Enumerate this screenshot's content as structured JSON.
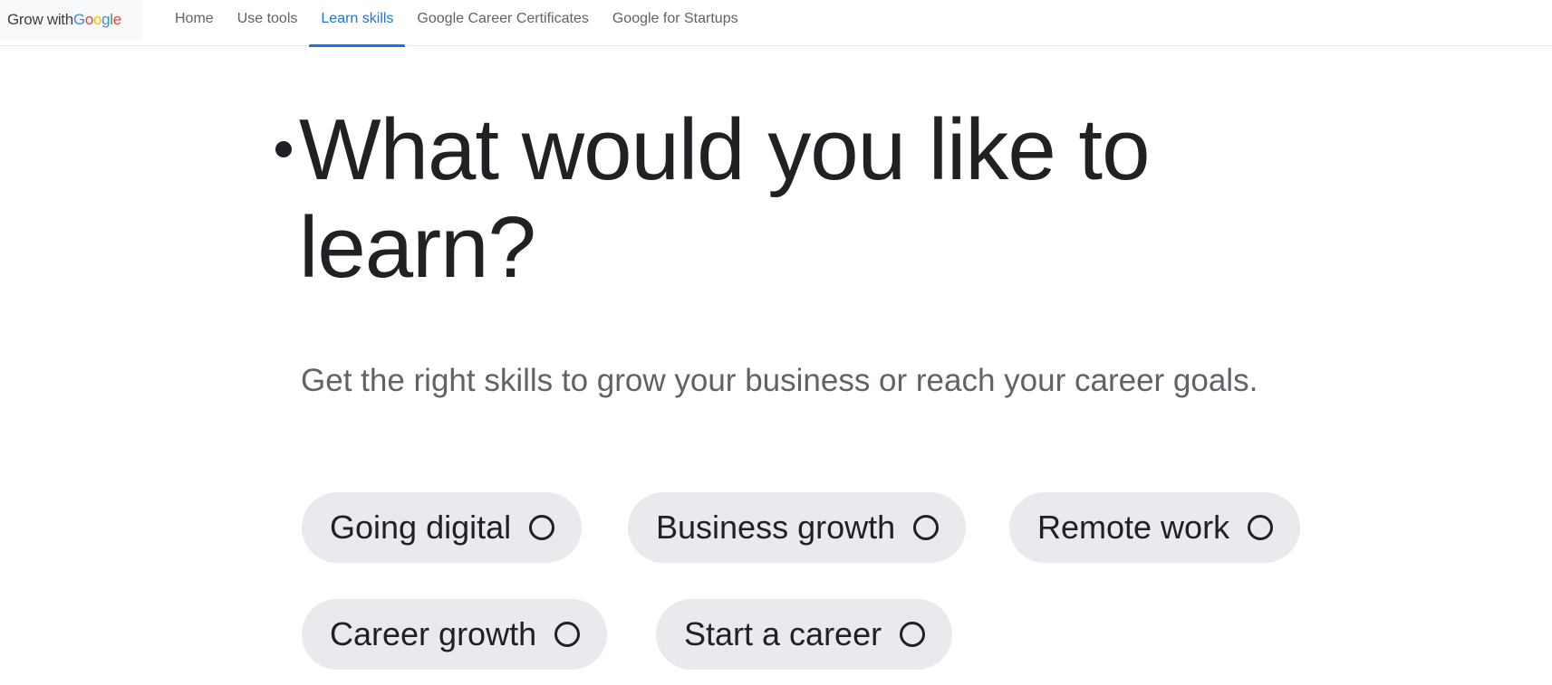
{
  "brand": {
    "prefix": "Grow with ",
    "letters": [
      {
        "ch": "G",
        "color": "#4285F4"
      },
      {
        "ch": "o",
        "color": "#EA4335"
      },
      {
        "ch": "o",
        "color": "#FBBC05"
      },
      {
        "ch": "g",
        "color": "#4285F4"
      },
      {
        "ch": "l",
        "color": "#34A853"
      },
      {
        "ch": "e",
        "color": "#EA4335"
      }
    ]
  },
  "nav": {
    "items": [
      {
        "label": "Home",
        "active": false
      },
      {
        "label": "Use tools",
        "active": false
      },
      {
        "label": "Learn skills",
        "active": true
      },
      {
        "label": "Google Career Certificates",
        "active": false
      },
      {
        "label": "Google for Startups",
        "active": false
      }
    ]
  },
  "hero": {
    "title": "What would you like to learn?",
    "subtitle": "Get the right skills to grow your business or reach your career goals."
  },
  "topics": [
    {
      "label": "Going digital",
      "icon": "radio-unchecked-icon"
    },
    {
      "label": "Business growth",
      "icon": "radio-unchecked-icon"
    },
    {
      "label": "Remote work",
      "icon": "radio-unchecked-icon"
    },
    {
      "label": "Career growth",
      "icon": "radio-unchecked-icon"
    },
    {
      "label": "Start a career",
      "icon": "radio-unchecked-icon"
    }
  ],
  "colors": {
    "accent": "#1a73e8",
    "chip_bg": "#e8eaed",
    "text": "#202124",
    "muted": "#5f6368"
  }
}
